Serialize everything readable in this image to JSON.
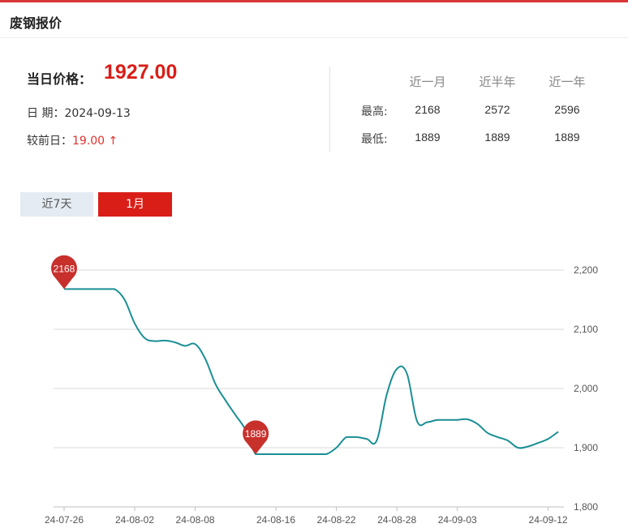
{
  "header": {
    "title": "废钢报价"
  },
  "summary": {
    "price_label": "当日价格：",
    "price_value": "1927.00",
    "date_label": "日 期：",
    "date_value": "2024-09-13",
    "change_label": "较前日：",
    "change_value": "19.00 ↑"
  },
  "stats": {
    "columns": [
      "近一月",
      "近半年",
      "近一年"
    ],
    "rows": [
      {
        "label": "最高:",
        "values": [
          "2168",
          "2572",
          "2596"
        ]
      },
      {
        "label": "最低:",
        "values": [
          "1889",
          "1889",
          "1889"
        ]
      }
    ]
  },
  "tabs": [
    {
      "label": "近7天",
      "active": false
    },
    {
      "label": "1月",
      "active": true
    }
  ],
  "colors": {
    "accent": "#d91e18",
    "line": "#1a8f94",
    "pin": "#c8302c"
  },
  "chart_data": {
    "type": "line",
    "x": [
      "24-07-26",
      "24-07-27",
      "24-07-28",
      "24-07-29",
      "24-07-30",
      "24-07-31",
      "24-08-01",
      "24-08-02",
      "24-08-03",
      "24-08-04",
      "24-08-05",
      "24-08-06",
      "24-08-07",
      "24-08-08",
      "24-08-09",
      "24-08-10",
      "24-08-11",
      "24-08-12",
      "24-08-13",
      "24-08-14",
      "24-08-15",
      "24-08-16",
      "24-08-17",
      "24-08-18",
      "24-08-19",
      "24-08-20",
      "24-08-21",
      "24-08-22",
      "24-08-23",
      "24-08-24",
      "24-08-25",
      "24-08-26",
      "24-08-27",
      "24-08-28",
      "24-08-29",
      "24-08-30",
      "24-08-31",
      "24-09-01",
      "24-09-02",
      "24-09-03",
      "24-09-04",
      "24-09-05",
      "24-09-06",
      "24-09-07",
      "24-09-08",
      "24-09-09",
      "24-09-10",
      "24-09-11",
      "24-09-12",
      "24-09-13"
    ],
    "series": [
      {
        "values": [
          2168,
          2168,
          2168,
          2168,
          2168,
          2168,
          2150,
          2110,
          2085,
          2080,
          2081,
          2078,
          2072,
          2075,
          2050,
          2008,
          1980,
          1955,
          1930,
          1889,
          1889,
          1889,
          1889,
          1889,
          1889,
          1889,
          1889,
          1900,
          1918,
          1918,
          1915,
          1912,
          1990,
          2033,
          2025,
          1945,
          1943,
          1947,
          1947,
          1947,
          1948,
          1940,
          1925,
          1918,
          1912,
          1900,
          1902,
          1908,
          1915,
          1927
        ]
      }
    ],
    "annotations": [
      {
        "x": "24-07-26",
        "y": 2168,
        "label": "2168"
      },
      {
        "x": "24-08-14",
        "y": 1889,
        "label": "1889"
      }
    ],
    "x_tick_labels": [
      "24-07-26",
      "24-08-02",
      "24-08-08",
      "24-08-16",
      "24-08-22",
      "24-08-28",
      "24-09-03",
      "24-09-12"
    ],
    "y_tick_labels": [
      "2,200",
      "2,100",
      "2,000",
      "1,900",
      "1,800"
    ],
    "y_ticks": [
      2200,
      2100,
      2000,
      1900,
      1800
    ],
    "ylim": [
      1800,
      2200
    ],
    "grid": true,
    "y_axis_position": "right"
  }
}
